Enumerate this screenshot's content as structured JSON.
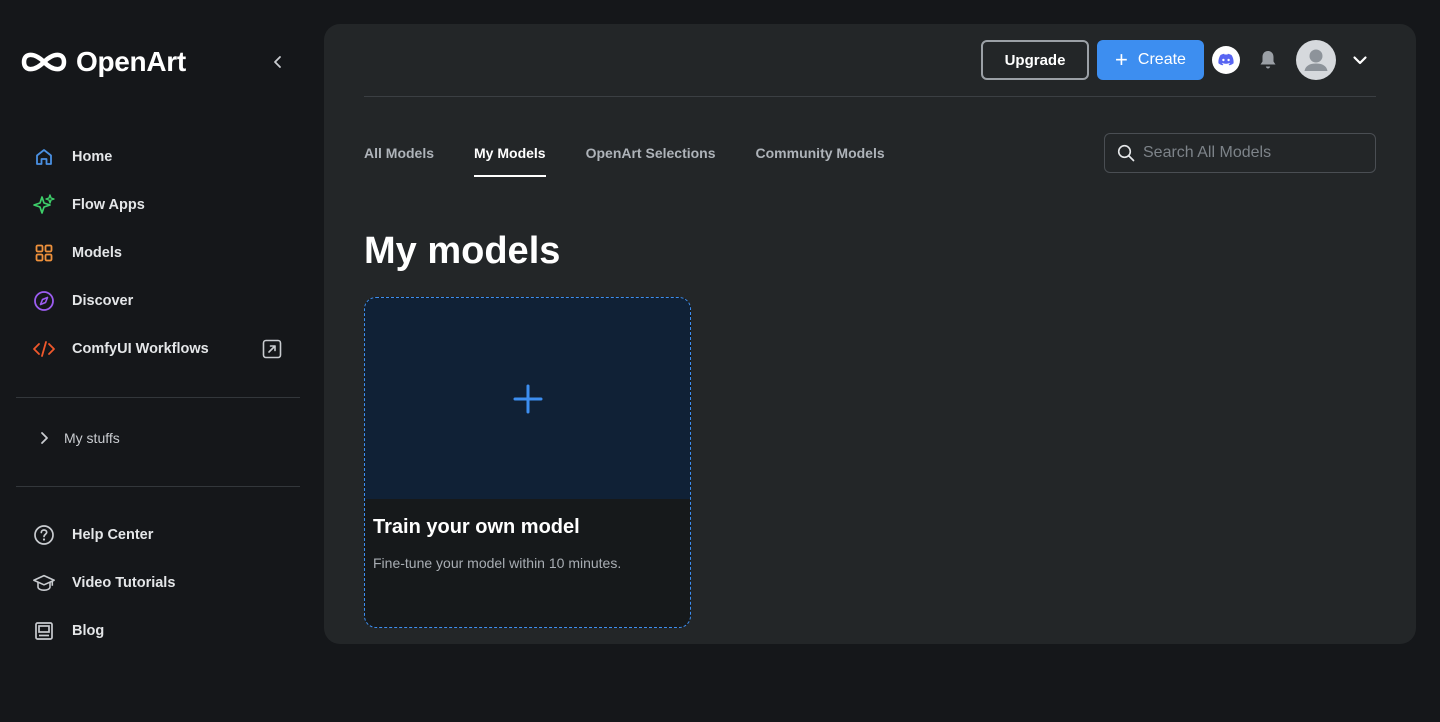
{
  "brand": {
    "name": "OpenArt"
  },
  "sidebar": {
    "items": [
      {
        "label": "Home",
        "icon": "home-icon",
        "color": "#4a90e2"
      },
      {
        "label": "Flow Apps",
        "icon": "sparkle-icon",
        "color": "#3ecf6a"
      },
      {
        "label": "Models",
        "icon": "grid-icon",
        "color": "#f0923c"
      },
      {
        "label": "Discover",
        "icon": "compass-icon",
        "color": "#9b5cf0"
      },
      {
        "label": "ComfyUI Workflows",
        "icon": "code-icon",
        "color": "#f0582c"
      }
    ],
    "my_stuffs": "My stuffs",
    "secondary": [
      {
        "label": "Help Center",
        "icon": "help-icon"
      },
      {
        "label": "Video Tutorials",
        "icon": "graduation-cap-icon"
      },
      {
        "label": "Blog",
        "icon": "blog-icon"
      }
    ]
  },
  "header": {
    "upgrade_label": "Upgrade",
    "create_label": "Create",
    "create_color": "#3d8ef0"
  },
  "tabs": [
    {
      "label": "All Models",
      "active": false
    },
    {
      "label": "My Models",
      "active": true
    },
    {
      "label": "OpenArt Selections",
      "active": false
    },
    {
      "label": "Community Models",
      "active": false
    }
  ],
  "search": {
    "placeholder": "Search All Models"
  },
  "main": {
    "title": "My models",
    "card": {
      "title": "Train your own model",
      "description": "Fine-tune your model within 10 minutes."
    }
  }
}
